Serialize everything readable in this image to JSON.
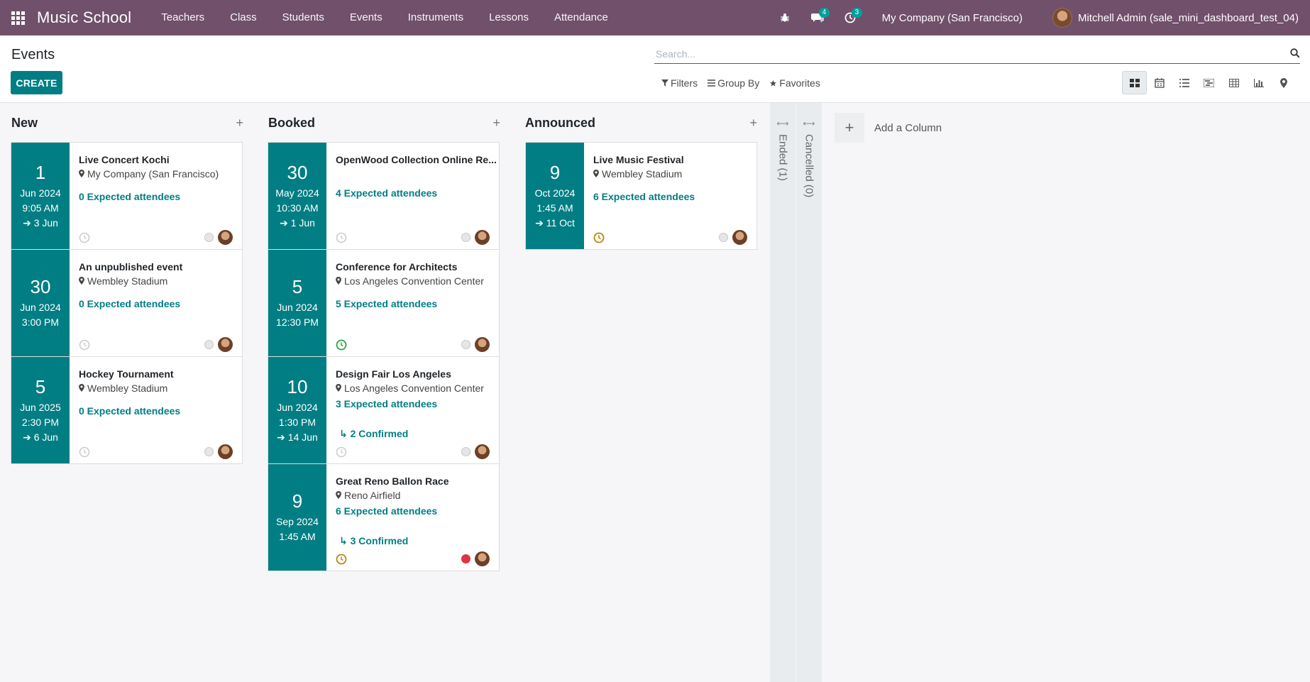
{
  "app": {
    "title": "Music School",
    "menu": [
      "Teachers",
      "Class",
      "Students",
      "Events",
      "Instruments",
      "Lessons",
      "Attendance"
    ],
    "messages_count": "4",
    "activities_count": "3",
    "company": "My Company (San Francisco)",
    "user": "Mitchell Admin (sale_mini_dashboard_test_04)"
  },
  "control": {
    "breadcrumb": "Events",
    "create_label": "CREATE",
    "search_placeholder": "Search...",
    "filters_label": "Filters",
    "groupby_label": "Group By",
    "favorites_label": "Favorites",
    "views": [
      "kanban-view",
      "calendar-view",
      "list-view",
      "gantt-view",
      "pivot-view",
      "graph-view",
      "map-view"
    ]
  },
  "columns": [
    {
      "title": "New",
      "cards": [
        {
          "day": "1",
          "month_year": "Jun 2024",
          "time": "9:05 AM",
          "end": "3 Jun",
          "title": "Live Concert Kochi",
          "location": "My Company (San Francisco)",
          "attendees": "0 Expected attendees",
          "confirmed": "",
          "clock": "grey",
          "state": "grey"
        },
        {
          "day": "30",
          "month_year": "Jun 2024",
          "time": "3:00 PM",
          "end": "",
          "title": "An unpublished event",
          "location": "Wembley Stadium",
          "attendees": "0 Expected attendees",
          "confirmed": "",
          "clock": "grey",
          "state": "grey"
        },
        {
          "day": "5",
          "month_year": "Jun 2025",
          "time": "2:30 PM",
          "end": "6 Jun",
          "title": "Hockey Tournament",
          "location": "Wembley Stadium",
          "attendees": "0 Expected attendees",
          "confirmed": "",
          "clock": "grey",
          "state": "grey"
        }
      ]
    },
    {
      "title": "Booked",
      "cards": [
        {
          "day": "30",
          "month_year": "May 2024",
          "time": "10:30 AM",
          "end": "1 Jun",
          "title": "OpenWood Collection Online Re...",
          "location": "",
          "attendees": "4 Expected attendees",
          "confirmed": "",
          "clock": "grey",
          "state": "grey"
        },
        {
          "day": "5",
          "month_year": "Jun 2024",
          "time": "12:30 PM",
          "end": "",
          "title": "Conference for Architects",
          "location": "Los Angeles Convention Center",
          "attendees": "5 Expected attendees",
          "confirmed": "",
          "clock": "green",
          "state": "grey"
        },
        {
          "day": "10",
          "month_year": "Jun 2024",
          "time": "1:30 PM",
          "end": "14 Jun",
          "title": "Design Fair Los Angeles",
          "location": "Los Angeles Convention Center",
          "attendees": "3 Expected attendees",
          "confirmed": "2 Confirmed",
          "clock": "grey",
          "state": "grey"
        },
        {
          "day": "9",
          "month_year": "Sep 2024",
          "time": "1:45 AM",
          "end": "",
          "title": "Great Reno Ballon Race",
          "location": "Reno Airfield",
          "attendees": "6 Expected attendees",
          "confirmed": "3 Confirmed",
          "clock": "amber",
          "state": "red"
        }
      ]
    },
    {
      "title": "Announced",
      "cards": [
        {
          "day": "9",
          "month_year": "Oct 2024",
          "time": "1:45 AM",
          "end": "11 Oct",
          "title": "Live Music Festival",
          "location": "Wembley Stadium",
          "attendees": "6 Expected attendees",
          "confirmed": "",
          "clock": "amber",
          "state": "grey"
        }
      ]
    }
  ],
  "folded_columns": [
    {
      "title": "Ended (1)"
    },
    {
      "title": "Cancelled (0)"
    }
  ],
  "add_column_label": "Add a Column",
  "colors": {
    "navbar": "#71506b",
    "accent": "#017e84",
    "badge": "#00a09d",
    "clock_green": "#28a745",
    "clock_amber": "#b8860b",
    "state_red": "#dc3545"
  }
}
